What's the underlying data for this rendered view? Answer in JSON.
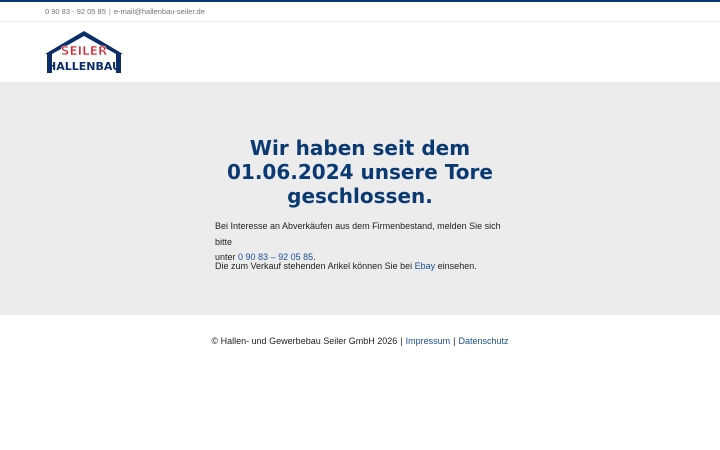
{
  "topbar": {
    "phone": "0 90 83 - 92 05 85",
    "separator": "|",
    "email": "e-mail@hallenbau-seiler.de"
  },
  "logo": {
    "line1": "SEILER",
    "line2": "HALLENBAU",
    "colors": {
      "navy": "#0b2e6b",
      "red": "#d5262b"
    }
  },
  "hero": {
    "headline_line1": "Wir haben seit dem",
    "headline_line2": "01.06.2024 unsere Tore",
    "headline_line3": "geschlossen.",
    "para1_text": "Bei Interesse an Abverkäufen aus dem Firmenbestand, melden Sie sich bitte",
    "para1_prefix": "unter",
    "para1_phone_link": "0 90 83 – 92 05 85",
    "para1_suffix": ".",
    "para2_prefix": "Die zum Verkauf stehenden Arikel können Sie bei",
    "para2_link": "Ebay",
    "para2_suffix": "einsehen."
  },
  "footer": {
    "copyright": "© Hallen- und Gewerbebau Seiler GmbH 2026",
    "separator": "|",
    "impressum": "Impressum",
    "datenschutz": "Datenschutz"
  },
  "colors": {
    "accent": "#0b3a73",
    "link": "#1b4f93",
    "hero_bg": "#ececec"
  }
}
